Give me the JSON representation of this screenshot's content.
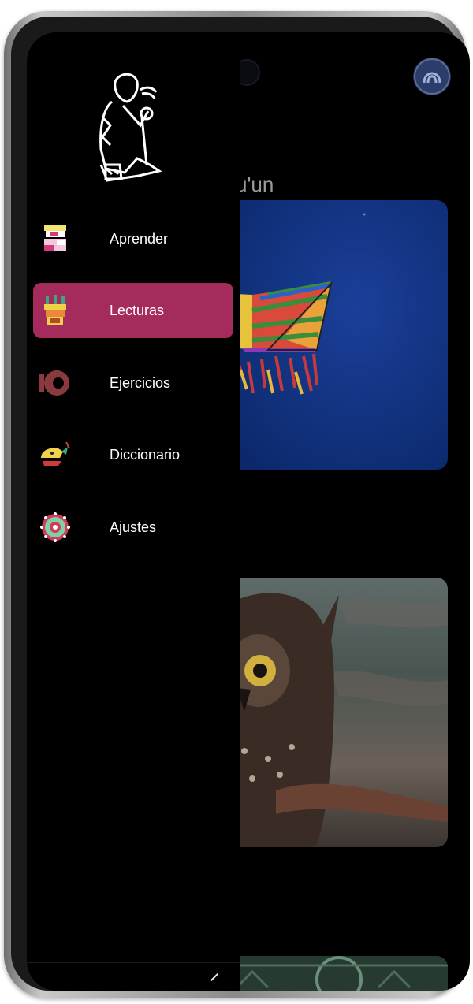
{
  "underlying": {
    "title_fragment": "u'un"
  },
  "drawer": {
    "items": [
      {
        "label": "Aprender",
        "icon": "aprender-glyph-icon",
        "active": false
      },
      {
        "label": "Lecturas",
        "icon": "lecturas-glyph-icon",
        "active": true
      },
      {
        "label": "Ejercicios",
        "icon": "ejercicios-glyph-icon",
        "active": false
      },
      {
        "label": "Diccionario",
        "icon": "diccionario-glyph-icon",
        "active": false
      },
      {
        "label": "Ajustes",
        "icon": "ajustes-glyph-icon",
        "active": false
      }
    ]
  },
  "colors": {
    "active_item": "#a42b5b",
    "drawer_bg": "#000000",
    "label_text": "#ffffff"
  }
}
